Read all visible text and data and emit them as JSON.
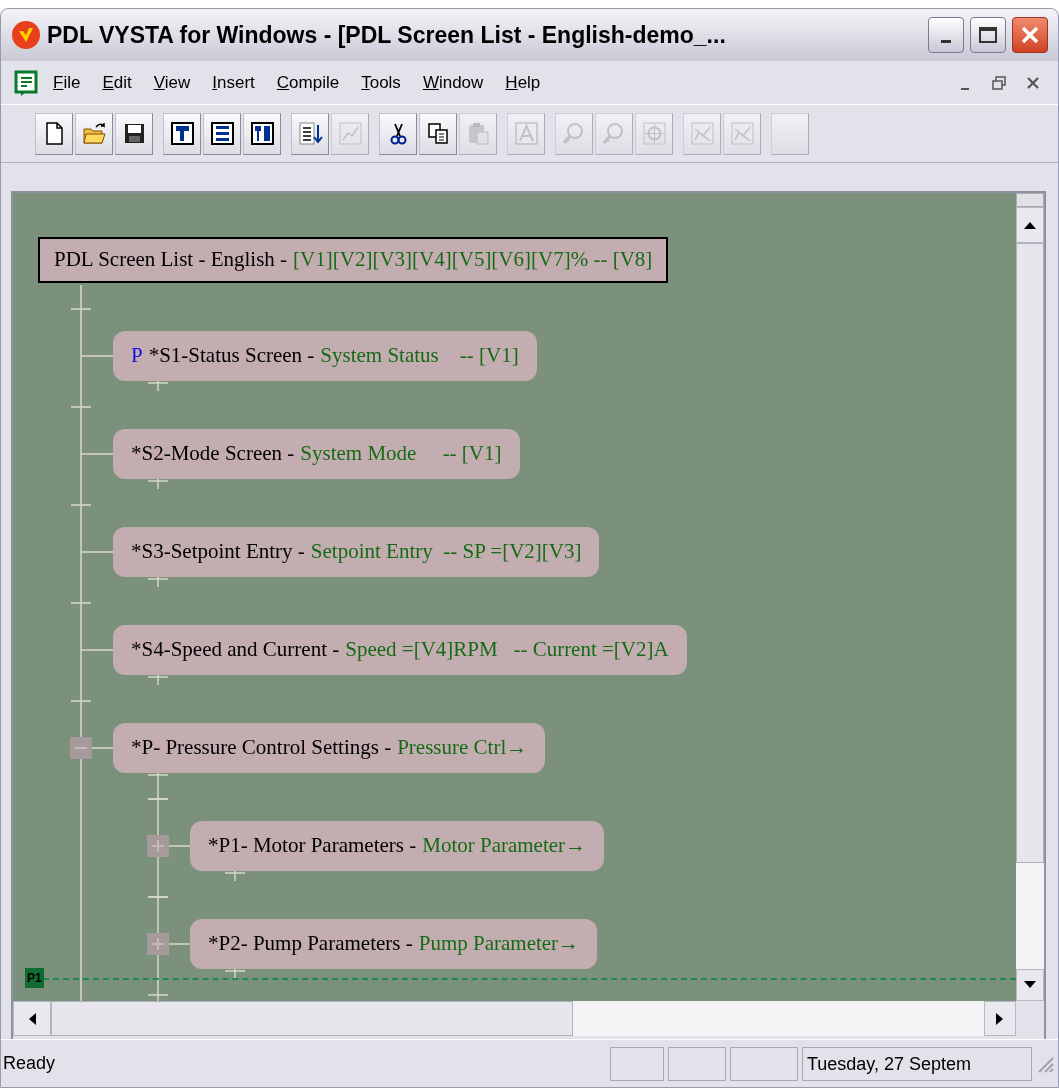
{
  "window": {
    "title": "PDL VYSTA for Windows - [PDL Screen List - English-demo_..."
  },
  "menu": [
    "File",
    "Edit",
    "View",
    "Insert",
    "Compile",
    "Tools",
    "Window",
    "Help"
  ],
  "toolbar_groups": [
    {
      "buttons": [
        {
          "kind": "new",
          "disabled": false
        },
        {
          "kind": "open",
          "disabled": false
        },
        {
          "kind": "save",
          "disabled": false
        }
      ]
    },
    {
      "buttons": [
        {
          "kind": "tree",
          "disabled": false
        },
        {
          "kind": "list",
          "disabled": false
        },
        {
          "kind": "split",
          "disabled": false
        }
      ]
    },
    {
      "buttons": [
        {
          "kind": "sort",
          "disabled": false
        },
        {
          "kind": "graph",
          "disabled": true
        }
      ]
    },
    {
      "buttons": [
        {
          "kind": "cut",
          "disabled": false
        },
        {
          "kind": "copy",
          "disabled": false
        },
        {
          "kind": "paste",
          "disabled": true
        }
      ]
    },
    {
      "buttons": [
        {
          "kind": "text",
          "disabled": true
        }
      ]
    },
    {
      "buttons": [
        {
          "kind": "zoom_in",
          "disabled": true
        },
        {
          "kind": "zoom_out",
          "disabled": true
        },
        {
          "kind": "zoom_fit",
          "disabled": true
        }
      ]
    },
    {
      "buttons": [
        {
          "kind": "chart",
          "disabled": true
        },
        {
          "kind": "chart",
          "disabled": true
        }
      ]
    },
    {
      "buttons": [
        {
          "kind": "partial",
          "disabled": true
        }
      ]
    }
  ],
  "canvas": {
    "root": {
      "name": "PDL Screen List - English -",
      "caption": "[V1][V2][V3][V4][V5][V6][V7]% -- [V8]",
      "selected": true,
      "children": [
        {
          "marker": "P",
          "name": "*S1-Status Screen -",
          "caption": "System Status    -- [V1]",
          "selected": false
        },
        {
          "name": "*S2-Mode Screen -",
          "caption": "System Mode     -- [V1]",
          "selected": false
        },
        {
          "name": "*S3-Setpoint Entry -",
          "caption": "Setpoint Entry  -- SP =[V2][V3]",
          "selected": false
        },
        {
          "name": "*S4-Speed and Current -",
          "caption": "Speed =[V4]RPM   -- Current =[V2]A",
          "selected": false
        },
        {
          "name": "*P- Pressure Control Settings -",
          "caption": "Pressure Ctrl→",
          "selected": false,
          "expanded": true,
          "children": [
            {
              "name": "*P1- Motor Parameters -",
              "caption": "Motor Parameter→",
              "selected": false,
              "expanded": false
            },
            {
              "name": "*P2- Pump Parameters -",
              "caption": "Pump Parameter→",
              "selected": false,
              "expanded": false
            }
          ]
        }
      ]
    },
    "page_break": {
      "label": "P1"
    }
  },
  "status_bar": {
    "message": "Ready",
    "date": "Tuesday, 27 Septem"
  }
}
